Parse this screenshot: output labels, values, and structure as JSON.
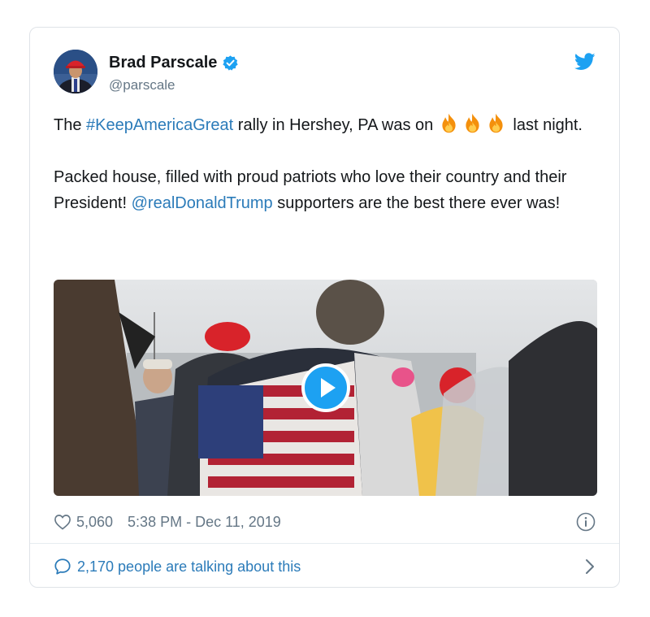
{
  "tweet": {
    "author_name": "Brad Parscale",
    "author_handle": "@parscale",
    "verified": true,
    "text_p1_before": "The ",
    "hashtag": "#KeepAmericaGreat",
    "text_p1_after": " rally in Hershey, PA was on ",
    "text_p1_end": " last night.",
    "text_p2_before": "Packed house, filled with proud patriots who love their country and their President! ",
    "mention": "@realDonaldTrump",
    "text_p2_after": " supporters are the best there ever was!",
    "likes": "5,060",
    "timestamp": "5:38 PM - Dec 11, 2019",
    "talking": "2,170 people are talking about this"
  },
  "colors": {
    "link": "#2b7bb9",
    "twitter_blue": "#1da1f2",
    "secondary_text": "#657786",
    "primary_text": "#14171a"
  },
  "icons": {
    "verified": "verified-badge-icon",
    "brand": "twitter-bird-icon",
    "like": "heart-outline-icon",
    "info": "info-circle-icon",
    "reply": "speech-bubble-icon",
    "chevron": "chevron-right-icon",
    "play": "play-icon",
    "emoji": "fire-emoji-icon"
  }
}
